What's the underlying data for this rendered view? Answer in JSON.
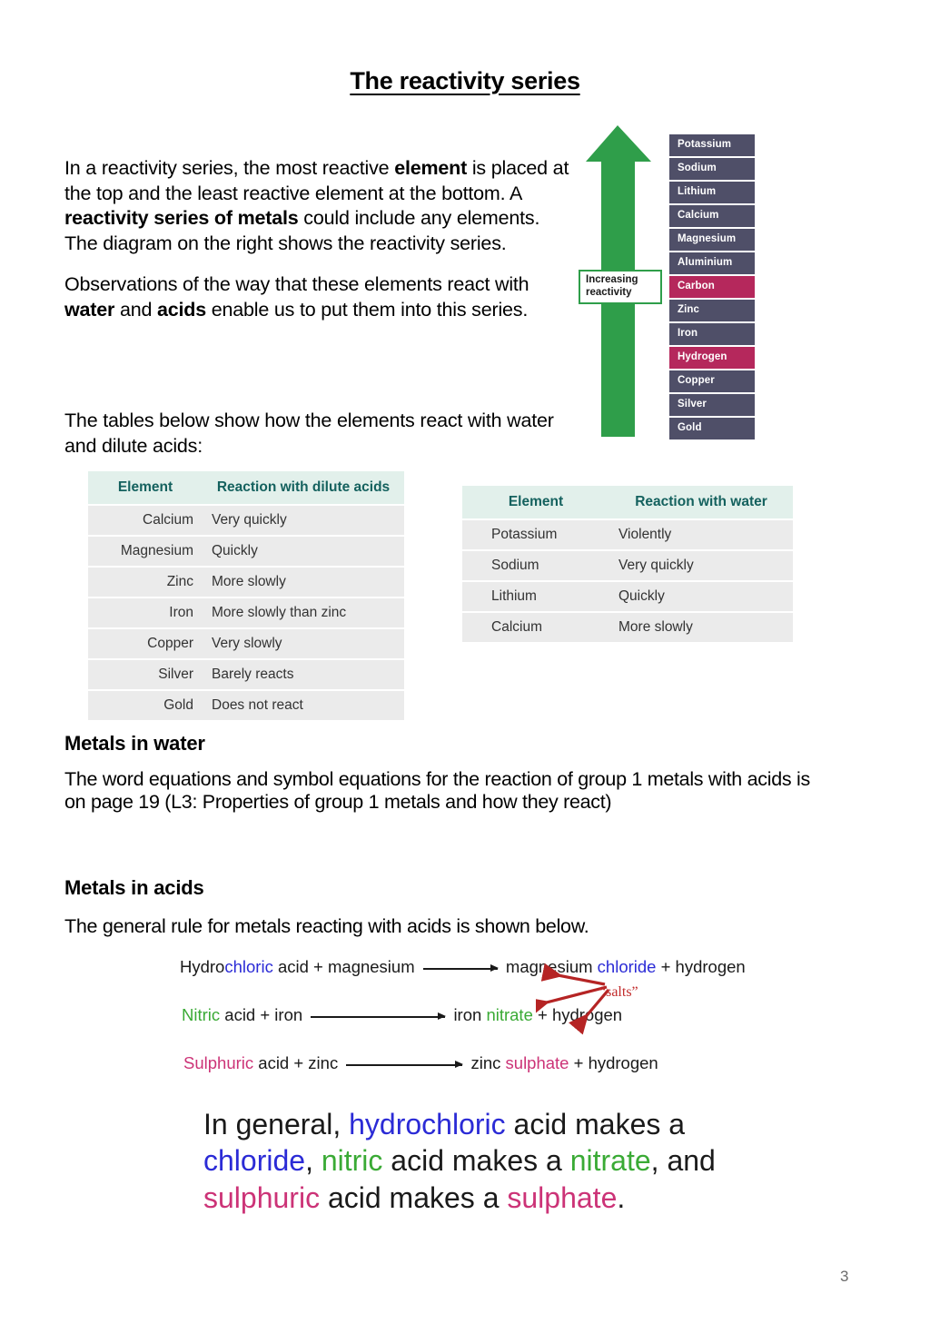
{
  "document": {
    "title": "The reactivity series",
    "page_number": "3"
  },
  "intro": {
    "paragraph1_parts": [
      {
        "text": "In a reactivity series, the most reactive ",
        "bold": false
      },
      {
        "text": "element",
        "bold": true
      },
      {
        "text": " is placed at the top and the least reactive element at the bottom. A ",
        "bold": false
      },
      {
        "text": "reactivity series of metals",
        "bold": true
      },
      {
        "text": " could include any elements. The diagram on the right shows the reactivity series.",
        "bold": false
      }
    ],
    "paragraph2_parts": [
      {
        "text": "Observations of the way that these elements react with ",
        "bold": false
      },
      {
        "text": "water",
        "bold": true
      },
      {
        "text": " and ",
        "bold": false
      },
      {
        "text": "acids",
        "bold": true
      },
      {
        "text": " enable us to put them into this series.",
        "bold": false
      }
    ],
    "tables_lead": "The tables below show how the elements react with water and dilute acids:"
  },
  "series_diagram": {
    "arrow_label": "Increasing reactivity",
    "arrow_color": "#2f9e4a",
    "box_color": "#4f4f68",
    "highlight_color": "#b5285c",
    "items": [
      {
        "label": "Potassium",
        "highlight": false
      },
      {
        "label": "Sodium",
        "highlight": false
      },
      {
        "label": "Lithium",
        "highlight": false
      },
      {
        "label": "Calcium",
        "highlight": false
      },
      {
        "label": "Magnesium",
        "highlight": false
      },
      {
        "label": "Aluminium",
        "highlight": false
      },
      {
        "label": "Carbon",
        "highlight": true
      },
      {
        "label": "Zinc",
        "highlight": false
      },
      {
        "label": "Iron",
        "highlight": false
      },
      {
        "label": "Hydrogen",
        "highlight": true
      },
      {
        "label": "Copper",
        "highlight": false
      },
      {
        "label": "Silver",
        "highlight": false
      },
      {
        "label": "Gold",
        "highlight": false
      }
    ]
  },
  "table_acids": {
    "headers": [
      "Element",
      "Reaction with dilute acids"
    ],
    "rows": [
      [
        "Calcium",
        "Very quickly"
      ],
      [
        "Magnesium",
        "Quickly"
      ],
      [
        "Zinc",
        "More slowly"
      ],
      [
        "Iron",
        "More slowly than zinc"
      ],
      [
        "Copper",
        "Very slowly"
      ],
      [
        "Silver",
        "Barely reacts"
      ],
      [
        "Gold",
        "Does not react"
      ]
    ]
  },
  "table_water": {
    "headers": [
      "Element",
      "Reaction with water"
    ],
    "rows": [
      [
        "Potassium",
        "Violently"
      ],
      [
        "Sodium",
        "Very quickly"
      ],
      [
        "Lithium",
        "Quickly"
      ],
      [
        "Calcium",
        "More slowly"
      ]
    ]
  },
  "metals_in_water": {
    "heading": "Metals in water",
    "paragraph": "The word equations and symbol equations for the reaction of group 1 metals with acids is on page 19 (L3: Properties of group 1 metals and how they react)"
  },
  "metals_in_acids": {
    "heading": "Metals in acids",
    "paragraph": "The general rule for metals reacting with acids is shown below."
  },
  "equations": {
    "salts_label": "“salts”",
    "rows": [
      {
        "left": [
          {
            "text": "Hydro",
            "color": "black"
          },
          {
            "text": "chloric",
            "color": "blue"
          },
          {
            "text": " acid + magnesium",
            "color": "black"
          }
        ],
        "right": [
          {
            "text": "magnesium ",
            "color": "black"
          },
          {
            "text": "chloride",
            "color": "blue"
          },
          {
            "text": " + hydrogen",
            "color": "black"
          }
        ]
      },
      {
        "left": [
          {
            "text": "Nitric",
            "color": "green"
          },
          {
            "text": " acid + iron",
            "color": "black"
          }
        ],
        "right": [
          {
            "text": "iron ",
            "color": "black"
          },
          {
            "text": "nitrate",
            "color": "green"
          },
          {
            "text": " + hydrogen",
            "color": "black"
          }
        ]
      },
      {
        "left": [
          {
            "text": "Sulphuric",
            "color": "magenta"
          },
          {
            "text": " acid + zinc",
            "color": "black"
          }
        ],
        "right": [
          {
            "text": "zinc ",
            "color": "black"
          },
          {
            "text": "sulphate",
            "color": "magenta"
          },
          {
            "text": " + hydrogen",
            "color": "black"
          }
        ]
      }
    ]
  },
  "summary": {
    "parts": [
      {
        "text": "In general, ",
        "color": "black"
      },
      {
        "text": "hydrochloric",
        "color": "blue"
      },
      {
        "text": " acid makes a ",
        "color": "black"
      },
      {
        "text": "chloride",
        "color": "blue"
      },
      {
        "text": ", ",
        "color": "black"
      },
      {
        "text": "nitric",
        "color": "green"
      },
      {
        "text": " acid makes a ",
        "color": "black"
      },
      {
        "text": "nitrate",
        "color": "green"
      },
      {
        "text": ", and ",
        "color": "black"
      },
      {
        "text": "sulphuric",
        "color": "magenta"
      },
      {
        "text": " acid makes a ",
        "color": "black"
      },
      {
        "text": "sulphate",
        "color": "magenta"
      },
      {
        "text": ".",
        "color": "black"
      }
    ]
  },
  "colors": {
    "blue": "#2b2bd6",
    "green": "#3aaa35",
    "magenta": "#cc3377",
    "red_annotation": "#c22b2b",
    "table_header_bg": "#e2f0eb",
    "table_header_text": "#14615e",
    "table_cell_bg": "#ebebeb"
  }
}
